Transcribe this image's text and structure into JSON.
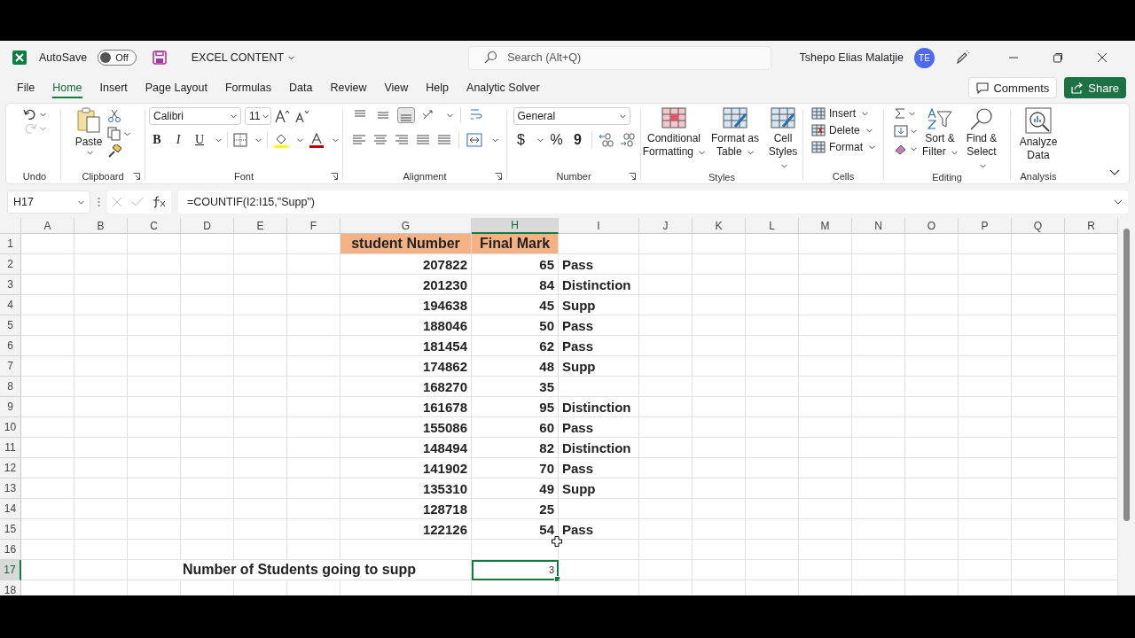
{
  "title_bar": {
    "autosave_label": "AutoSave",
    "autosave": {
      "label": "Off",
      "on": false
    },
    "document_title": "EXCEL CONTENT",
    "search": {
      "placeholder": "Search (Alt+Q)"
    },
    "user_name": "Tshepo Elias Malatjie",
    "user_initials": "TE"
  },
  "menu_tabs": [
    {
      "label": "File",
      "selected": false
    },
    {
      "label": "Home",
      "selected": true
    },
    {
      "label": "Insert",
      "selected": false
    },
    {
      "label": "Page Layout",
      "selected": false
    },
    {
      "label": "Formulas",
      "selected": false
    },
    {
      "label": "Data",
      "selected": false
    },
    {
      "label": "Review",
      "selected": false
    },
    {
      "label": "View",
      "selected": false
    },
    {
      "label": "Help",
      "selected": false
    },
    {
      "label": "Analytic Solver",
      "selected": false
    }
  ],
  "actions": {
    "comments": "Comments",
    "share": "Share"
  },
  "ribbon": {
    "groups": [
      {
        "label": "Undo"
      },
      {
        "label": "Clipboard",
        "buttons": [
          "Paste"
        ]
      },
      {
        "label": "Font",
        "font_name": "Calibri",
        "font_size": "11",
        "buttons": [
          "B",
          "I",
          "U"
        ]
      },
      {
        "label": "Alignment"
      },
      {
        "label": "Number",
        "format": "General",
        "buttons": [
          "$",
          "%",
          "9"
        ]
      },
      {
        "label": "Styles",
        "buttons": [
          "Conditional Formatting",
          "Format as Table",
          "Cell Styles"
        ]
      },
      {
        "label": "Cells",
        "buttons": [
          "Insert",
          "Delete",
          "Format"
        ]
      },
      {
        "label": "Editing",
        "buttons": [
          "Sort & Filter",
          "Find & Select"
        ]
      },
      {
        "label": "Analysis",
        "buttons": [
          "Analyze Data"
        ]
      }
    ]
  },
  "formula_bar": {
    "name_box": "H17",
    "formula": "=COUNTIF(I2:I15,\"Supp\")"
  },
  "sheet": {
    "columns": [
      {
        "label": "A",
        "selected": false
      },
      {
        "label": "B",
        "selected": false
      },
      {
        "label": "C",
        "selected": false
      },
      {
        "label": "D",
        "selected": false
      },
      {
        "label": "E",
        "selected": false
      },
      {
        "label": "F",
        "selected": false
      },
      {
        "label": "G",
        "selected": false
      },
      {
        "label": "H",
        "selected": true
      },
      {
        "label": "I",
        "selected": false
      },
      {
        "label": "J",
        "selected": false
      },
      {
        "label": "K",
        "selected": false
      },
      {
        "label": "L",
        "selected": false
      },
      {
        "label": "M",
        "selected": false
      },
      {
        "label": "N",
        "selected": false
      },
      {
        "label": "O",
        "selected": false
      },
      {
        "label": "P",
        "selected": false
      },
      {
        "label": "Q",
        "selected": false
      },
      {
        "label": "R",
        "selected": false
      }
    ],
    "rows": [
      {
        "number": "1",
        "selected": false,
        "kind": "header",
        "student_number": "student Number",
        "final_mark": "Final Mark"
      },
      {
        "number": "2",
        "selected": false,
        "kind": "record",
        "student_number": "207822",
        "final_mark": "65",
        "result": "Pass"
      },
      {
        "number": "3",
        "selected": false,
        "kind": "record",
        "student_number": "201230",
        "final_mark": "84",
        "result": "Distinction"
      },
      {
        "number": "4",
        "selected": false,
        "kind": "record",
        "student_number": "194638",
        "final_mark": "45",
        "result": "Supp"
      },
      {
        "number": "5",
        "selected": false,
        "kind": "record",
        "student_number": "188046",
        "final_mark": "50",
        "result": "Pass"
      },
      {
        "number": "6",
        "selected": false,
        "kind": "record",
        "student_number": "181454",
        "final_mark": "62",
        "result": "Pass"
      },
      {
        "number": "7",
        "selected": false,
        "kind": "record",
        "student_number": "174862",
        "final_mark": "48",
        "result": "Supp"
      },
      {
        "number": "8",
        "selected": false,
        "kind": "record",
        "student_number": "168270",
        "final_mark": "35"
      },
      {
        "number": "9",
        "selected": false,
        "kind": "record",
        "student_number": "161678",
        "final_mark": "95",
        "result": "Distinction"
      },
      {
        "number": "10",
        "selected": false,
        "kind": "record",
        "student_number": "155086",
        "final_mark": "60",
        "result": "Pass"
      },
      {
        "number": "11",
        "selected": false,
        "kind": "record",
        "student_number": "148494",
        "final_mark": "82",
        "result": "Distinction"
      },
      {
        "number": "12",
        "selected": false,
        "kind": "record",
        "student_number": "141902",
        "final_mark": "70",
        "result": "Pass"
      },
      {
        "number": "13",
        "selected": false,
        "kind": "record",
        "student_number": "135310",
        "final_mark": "49",
        "result": "Supp"
      },
      {
        "number": "14",
        "selected": false,
        "kind": "record",
        "student_number": "128718",
        "final_mark": "25"
      },
      {
        "number": "15",
        "selected": false,
        "kind": "record",
        "student_number": "122126",
        "final_mark": "54",
        "result": "Pass"
      },
      {
        "number": "16",
        "selected": false,
        "kind": "empty"
      },
      {
        "number": "17",
        "selected": true,
        "kind": "summary",
        "label": "Number of Students going to supp",
        "value": "3"
      },
      {
        "number": "18",
        "selected": false,
        "kind": "empty"
      }
    ]
  }
}
